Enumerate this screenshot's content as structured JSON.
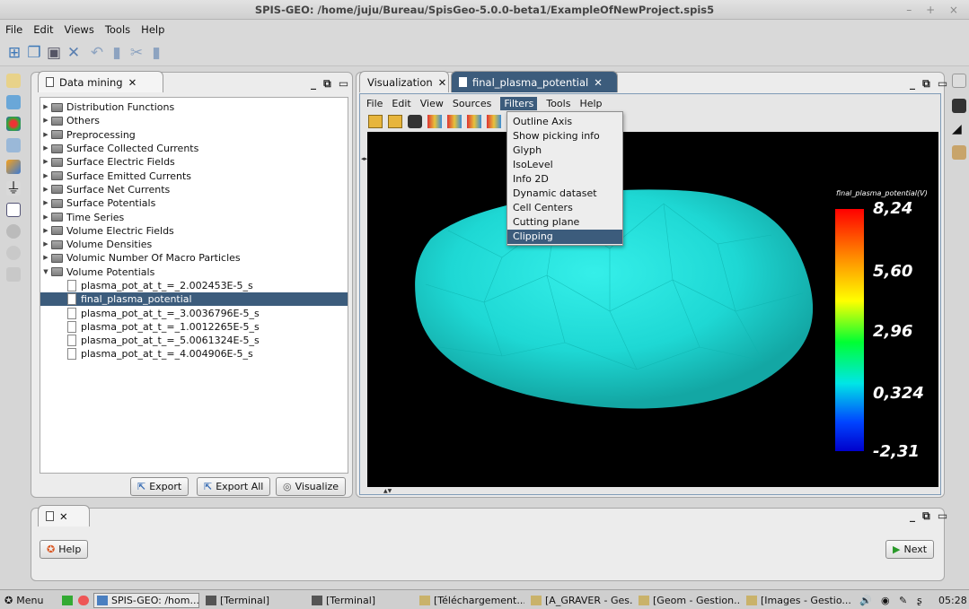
{
  "window": {
    "title": "SPIS-GEO: /home/juju/Bureau/SpisGeo-5.0.0-beta1/ExampleOfNewProject.spis5",
    "controls": "– + ×"
  },
  "menubar": [
    "File",
    "Edit",
    "Views",
    "Tools",
    "Help"
  ],
  "data_mining": {
    "tab_label": "Data mining",
    "tree": [
      {
        "label": "Distribution Functions",
        "type": "folder",
        "expanded": false
      },
      {
        "label": "Others",
        "type": "folder",
        "expanded": false
      },
      {
        "label": "Preprocessing",
        "type": "folder",
        "expanded": false
      },
      {
        "label": "Surface Collected Currents",
        "type": "folder",
        "expanded": false
      },
      {
        "label": "Surface Electric Fields",
        "type": "folder",
        "expanded": false
      },
      {
        "label": "Surface Emitted Currents",
        "type": "folder",
        "expanded": false
      },
      {
        "label": "Surface Net Currents",
        "type": "folder",
        "expanded": false
      },
      {
        "label": "Surface Potentials",
        "type": "folder",
        "expanded": false
      },
      {
        "label": "Time Series",
        "type": "folder",
        "expanded": false
      },
      {
        "label": "Volume Electric Fields",
        "type": "folder",
        "expanded": false
      },
      {
        "label": "Volume Densities",
        "type": "folder",
        "expanded": false
      },
      {
        "label": "Volumic Number Of Macro Particles",
        "type": "folder",
        "expanded": false
      },
      {
        "label": "Volume Potentials",
        "type": "folder",
        "expanded": true
      },
      {
        "label": "plasma_pot_at_t_=_2.002453E-5_s",
        "type": "file",
        "selected": false
      },
      {
        "label": "final_plasma_potential",
        "type": "file",
        "selected": true
      },
      {
        "label": "plasma_pot_at_t_=_3.0036796E-5_s",
        "type": "file",
        "selected": false
      },
      {
        "label": "plasma_pot_at_t_=_1.0012265E-5_s",
        "type": "file",
        "selected": false
      },
      {
        "label": "plasma_pot_at_t_=_5.0061324E-5_s",
        "type": "file",
        "selected": false
      },
      {
        "label": "plasma_pot_at_t_=_4.004906E-5_s",
        "type": "file",
        "selected": false
      }
    ],
    "buttons": {
      "export": "Export",
      "export_all": "Export All",
      "visualize": "Visualize"
    }
  },
  "visualization": {
    "tabs": [
      {
        "label": "Visualization",
        "active": false
      },
      {
        "label": "final_plasma_potential",
        "active": true
      }
    ],
    "menu": [
      "File",
      "Edit",
      "View",
      "Sources",
      "Filters",
      "Tools",
      "Help"
    ],
    "active_menu": "Filters",
    "filters_menu": [
      {
        "label": "Outline Axis",
        "selected": false
      },
      {
        "label": "Show picking info",
        "selected": false
      },
      {
        "label": "Glyph",
        "selected": false
      },
      {
        "label": "IsoLevel",
        "selected": false
      },
      {
        "label": "Info 2D",
        "selected": false
      },
      {
        "label": "Dynamic dataset",
        "selected": false
      },
      {
        "label": "Cell Centers",
        "selected": false
      },
      {
        "label": "Cutting plane",
        "selected": false
      },
      {
        "label": "Clipping",
        "selected": true
      }
    ],
    "colorbar": {
      "title": "final_plasma_potential(V)",
      "labels": [
        "8,24",
        "5,60",
        "2,96",
        "0,324",
        "-2,31"
      ]
    },
    "shape_color": "#1ed8d4"
  },
  "bottom_panel": {
    "help": "Help",
    "next": "Next"
  },
  "taskbar": {
    "menu": "Menu",
    "tasks": [
      {
        "label": "SPIS-GEO: /hom...",
        "active": true
      },
      {
        "label": "[Terminal]",
        "active": false
      },
      {
        "label": "[Terminal]",
        "active": false
      },
      {
        "label": "[Téléchargement...",
        "active": false
      },
      {
        "label": "[A_GRAVER - Ges...",
        "active": false
      },
      {
        "label": "[Geom - Gestion...",
        "active": false
      },
      {
        "label": "[Images - Gestio...",
        "active": false
      }
    ],
    "clock": "05:28"
  }
}
